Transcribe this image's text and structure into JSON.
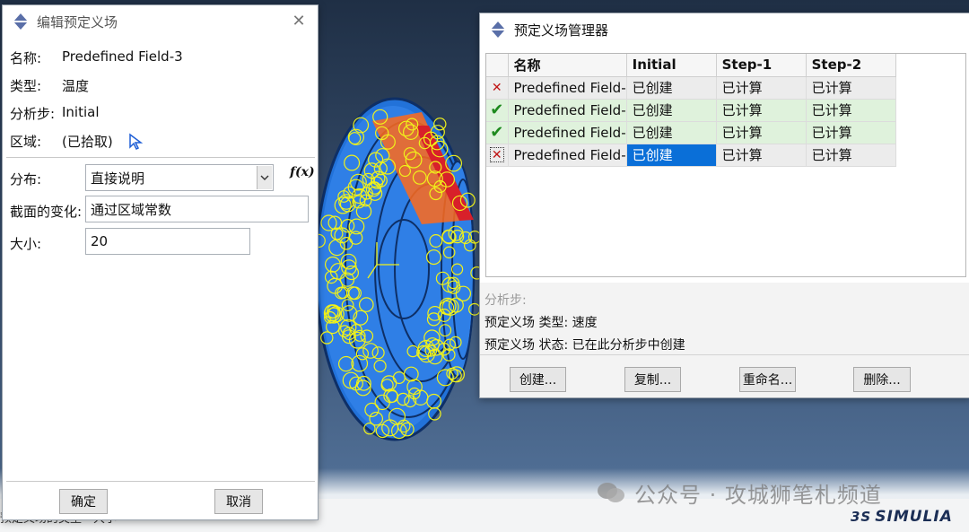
{
  "edit_dialog": {
    "title": "编辑预定义场",
    "close_glyph": "✕",
    "name_label": "名称:",
    "name_value": "Predefined Field-3",
    "type_label": "类型:",
    "type_value": "温度",
    "step_label": "分析步:",
    "step_value": "Initial",
    "region_label": "区域:",
    "region_value": "(已拾取)",
    "distribution_label": "分布:",
    "distribution_value": "直接说明",
    "fx_label": "f(x)",
    "section_variation_label": "截面的变化:",
    "section_variation_value": "通过区域常数",
    "magnitude_label": "大小:",
    "magnitude_value": "20",
    "ok_button": "确定",
    "cancel_button": "取消"
  },
  "manager_dialog": {
    "title": "预定义场管理器",
    "columns": [
      "名称",
      "Initial",
      "Step-1",
      "Step-2"
    ],
    "rows": [
      {
        "mark": "✕",
        "status": "error",
        "name": "Predefined Field-",
        "initial": "已创建",
        "step1": "已计算",
        "step2": "已计算"
      },
      {
        "mark": "✔",
        "status": "ok",
        "name": "Predefined Field-",
        "initial": "已创建",
        "step1": "已计算",
        "step2": "已计算"
      },
      {
        "mark": "✔",
        "status": "ok",
        "name": "Predefined Field-",
        "initial": "已创建",
        "step1": "已计算",
        "step2": "已计算"
      },
      {
        "mark": "✕",
        "status": "error",
        "name": "Predefined Field-",
        "initial": "已创建",
        "step1": "已计算",
        "step2": "已计算"
      }
    ],
    "info_step_label": "分析步:",
    "info_type": "预定义场 类型: 速度",
    "info_status": "预定义场 状态: 已在此分析步中创建",
    "buttons": {
      "create": "创建...",
      "copy": "复制...",
      "rename": "重命名...",
      "delete": "删除..."
    }
  },
  "viewport": {
    "command_text": "预定义场的类型 - 大小",
    "watermark": "公众号 · 攻城狮笔札频道",
    "brand": "SIMULIA",
    "brand_mark": "3S"
  },
  "colors": {
    "selection": "#0a6fd8",
    "row_green": "#dff2dc",
    "row_gray": "#ececec",
    "error_mark": "#c01414",
    "ok_mark": "#1e8a1e",
    "model_blue": "#2f7fe6",
    "node_yellow": "#f0f21a",
    "highlight_orange": "#ff6a1a"
  },
  "icons": {
    "app": "abaqus-diamond-icon",
    "close": "close-icon",
    "pick": "cursor-arrow-icon",
    "dropdown": "chevron-down-icon",
    "watermark": "wechat-icon",
    "brand": "ds-logo-icon"
  }
}
